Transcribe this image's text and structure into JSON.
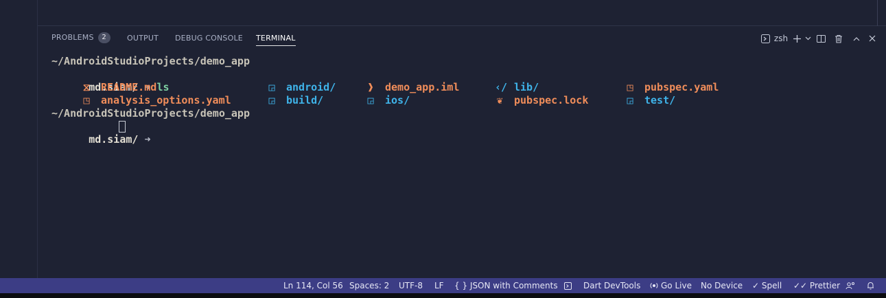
{
  "panel": {
    "tabs": [
      {
        "label": "PROBLEMS",
        "badge": "2"
      },
      {
        "label": "OUTPUT"
      },
      {
        "label": "DEBUG CONSOLE"
      },
      {
        "label": "TERMINAL",
        "active": true
      }
    ],
    "terminal_profile": "zsh"
  },
  "terminal": {
    "cwd": "~/AndroidStudioProjects/demo_app",
    "prompt_user": "md.siam/",
    "prompt_arrow": "➜",
    "command": "ls",
    "listing": [
      {
        "name": "README.md",
        "kind": "file",
        "icon": "markdown-icon",
        "glyph": "⧖"
      },
      {
        "name": "android/",
        "kind": "dir",
        "icon": "folder-icon",
        "glyph": "◲"
      },
      {
        "name": "demo_app.iml",
        "kind": "file",
        "icon": "iml-icon",
        "glyph": "❱"
      },
      {
        "name": "lib/",
        "kind": "dir",
        "icon": "code-folder-icon",
        "glyph": "‹/"
      },
      {
        "name": "pubspec.yaml",
        "kind": "file",
        "icon": "yaml-icon",
        "glyph": "◳"
      },
      {
        "name": "analysis_options.yaml",
        "kind": "file",
        "icon": "yaml-icon",
        "glyph": "◳"
      },
      {
        "name": "build/",
        "kind": "dir",
        "icon": "folder-icon",
        "glyph": "◲"
      },
      {
        "name": "ios/",
        "kind": "dir",
        "icon": "folder-icon",
        "glyph": "◲"
      },
      {
        "name": "pubspec.lock",
        "kind": "file",
        "icon": "lock-file-icon",
        "glyph": "❦"
      },
      {
        "name": "test/",
        "kind": "dir",
        "icon": "folder-icon",
        "glyph": "◲"
      }
    ]
  },
  "status_bar": {
    "position": "Ln 114, Col 56",
    "spaces": "Spaces: 2",
    "encoding": "UTF-8",
    "eol": "LF",
    "language": "{ }  JSON with Comments",
    "dart_devtools": "Dart DevTools",
    "go_live": "Go Live",
    "device": "No Device",
    "spell": "✓ Spell",
    "prettier": "✓✓ Prettier"
  },
  "colors": {
    "background": "#1e2233",
    "status_bar": "#3c3d85",
    "file": "#f08d5a",
    "directory": "#3fb4ea",
    "command": "#7fd1a3"
  }
}
